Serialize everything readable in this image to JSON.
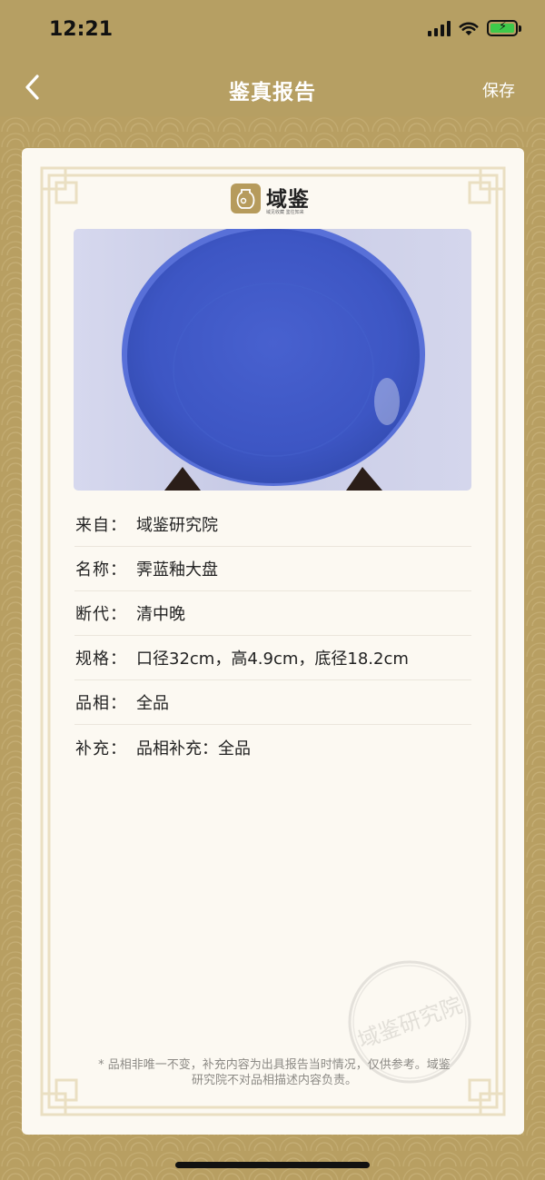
{
  "status_bar": {
    "time": "12:21"
  },
  "nav": {
    "title": "鉴真报告",
    "save_label": "保存"
  },
  "logo": {
    "name": "域鉴",
    "tagline": "域见收藏 鉴往知来"
  },
  "item_photo": {
    "description_color": "#3f58c6"
  },
  "details": [
    {
      "label": "来自：",
      "value": "域鉴研究院"
    },
    {
      "label": "名称：",
      "value": "霁蓝釉大盘"
    },
    {
      "label": "断代：",
      "value": "清中晚"
    },
    {
      "label": "规格：",
      "value": "口径32cm，高4.9cm，底径18.2cm"
    },
    {
      "label": "品相：",
      "value": "全品"
    },
    {
      "label": "补充：",
      "value": "品相补充：全品"
    }
  ],
  "stamp_text": "域鉴研究院",
  "disclaimer": "* 品相非唯一不变，补充内容为出具报告当时情况，仅供参考。域鉴研究院不对品相描述内容负责。",
  "colors": {
    "gold": "#b69f63",
    "card": "#fcf9f2",
    "plate_blue": "#3f58c6",
    "frame": "#e8dcbf"
  }
}
